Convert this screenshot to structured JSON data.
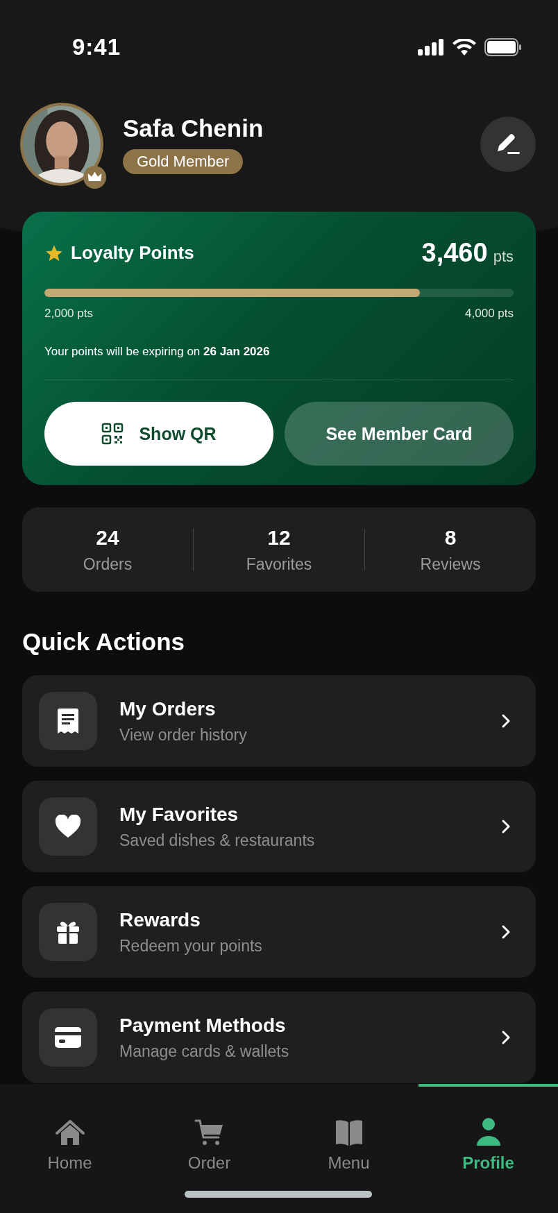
{
  "status_bar": {
    "time": "9:41"
  },
  "profile": {
    "name": "Safa Chenin",
    "tier": "Gold Member"
  },
  "loyalty": {
    "title": "Loyalty Points",
    "points": "3,460",
    "unit": "pts",
    "level": 0.8,
    "min_label": "2,000 pts",
    "max_label": "4,000 pts",
    "expiry": "Your points will be expiring on **26 Jan 2026**",
    "buttons": [
      {
        "label": "Show QR",
        "kind": "primary"
      },
      {
        "label": "See Member Card",
        "kind": "secondary"
      }
    ]
  },
  "stats": [
    {
      "value": "24",
      "label": "Orders"
    },
    {
      "value": "12",
      "label": "Favorites"
    },
    {
      "value": "8",
      "label": "Reviews"
    }
  ],
  "quick_actions": {
    "title": "Quick Actions",
    "items": [
      {
        "title": "My Orders",
        "subtitle": "View order history"
      },
      {
        "title": "My Favorites",
        "subtitle": "Saved dishes & restaurants"
      },
      {
        "title": "Rewards",
        "subtitle": "Redeem your points"
      },
      {
        "title": "Payment Methods",
        "subtitle": "Manage cards & wallets"
      }
    ]
  },
  "tab_bar": [
    {
      "label": "Home",
      "selected": false
    },
    {
      "label": "Order",
      "selected": false
    },
    {
      "label": "Menu",
      "selected": false
    },
    {
      "label": "Profile",
      "selected": true
    }
  ]
}
